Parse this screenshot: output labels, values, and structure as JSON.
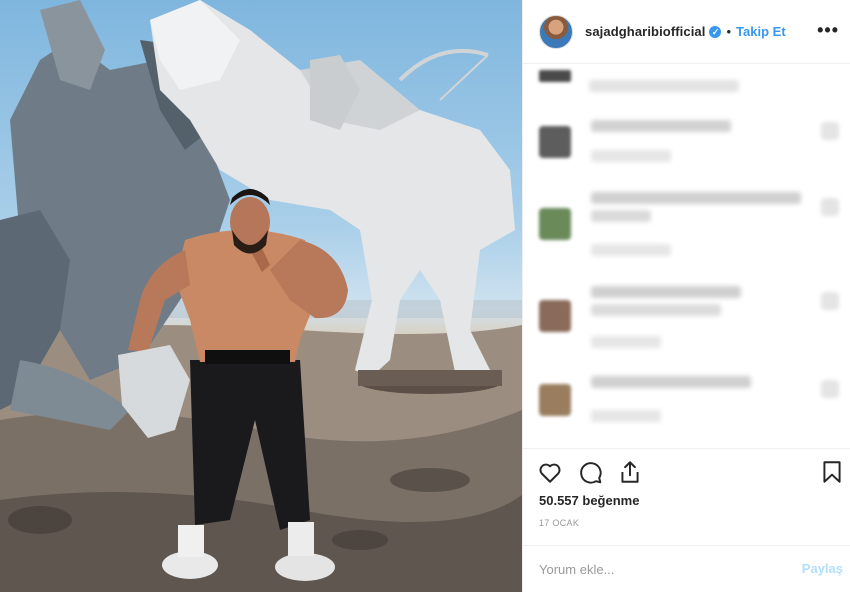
{
  "post": {
    "photo_alt": "",
    "header": {
      "username": "sajadgharibiofficial",
      "verified": true,
      "separator": "•",
      "follow_label": "Takip Et",
      "more_icon": "more-horizontal-icon",
      "more_label": "•••"
    },
    "comments_blurred": true,
    "actions": {
      "like_icon": "heart-outline-icon",
      "comment_icon": "comment-bubble-icon",
      "share_icon": "share-upload-icon",
      "save_icon": "bookmark-icon"
    },
    "likes": "50.557 beğenme",
    "date": "17 OCAK",
    "comment_box": {
      "placeholder": "Yorum ekle...",
      "post_label": "Paylaş"
    }
  },
  "colors": {
    "accent": "#3897f0",
    "post_disabled": "#b2dffc",
    "text": "#262626",
    "muted": "#999999",
    "border": "#efefef"
  }
}
